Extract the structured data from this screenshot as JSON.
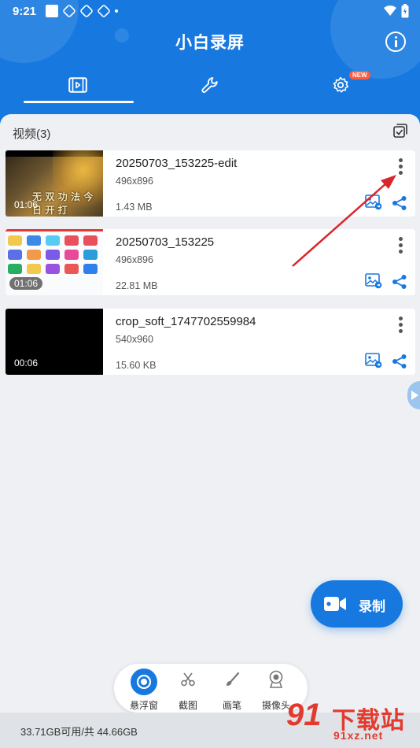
{
  "status_bar": {
    "time": "9:21"
  },
  "header": {
    "title": "小白录屏",
    "tabs": [
      {
        "name": "videos",
        "icon": "film-icon"
      },
      {
        "name": "tools",
        "icon": "wrench-icon"
      },
      {
        "name": "settings",
        "icon": "gear-icon",
        "badge": "NEW"
      }
    ],
    "active_tab": 0
  },
  "list": {
    "section_title": "视频(3)",
    "videos": [
      {
        "name": "20250703_153225-edit",
        "resolution": "496x896",
        "size": "1.43 MB",
        "duration": "01:06",
        "thumb_text": "无 双 功 法 今 日 开 打"
      },
      {
        "name": "20250703_153225",
        "resolution": "496x896",
        "size": "22.81 MB",
        "duration": "01:06"
      },
      {
        "name": "crop_soft_1747702559984",
        "resolution": "540x960",
        "size": "15.60 KB",
        "duration": "00:06"
      }
    ]
  },
  "record_button": {
    "label": "录制"
  },
  "toolbar": {
    "items": [
      {
        "label": "悬浮窗",
        "icon": "floating-window-icon"
      },
      {
        "label": "截图",
        "icon": "scissors-icon"
      },
      {
        "label": "画笔",
        "icon": "brush-icon"
      },
      {
        "label": "摄像头",
        "icon": "camera-icon"
      }
    ]
  },
  "storage": {
    "text": "33.71GB可用/共 44.66GB"
  },
  "watermark": {
    "number": "91",
    "title": "下载站",
    "url": "91xz.net"
  },
  "colors": {
    "primary": "#1779e0",
    "accent_red": "#e23a2f",
    "badge": "#ff5a3c"
  }
}
